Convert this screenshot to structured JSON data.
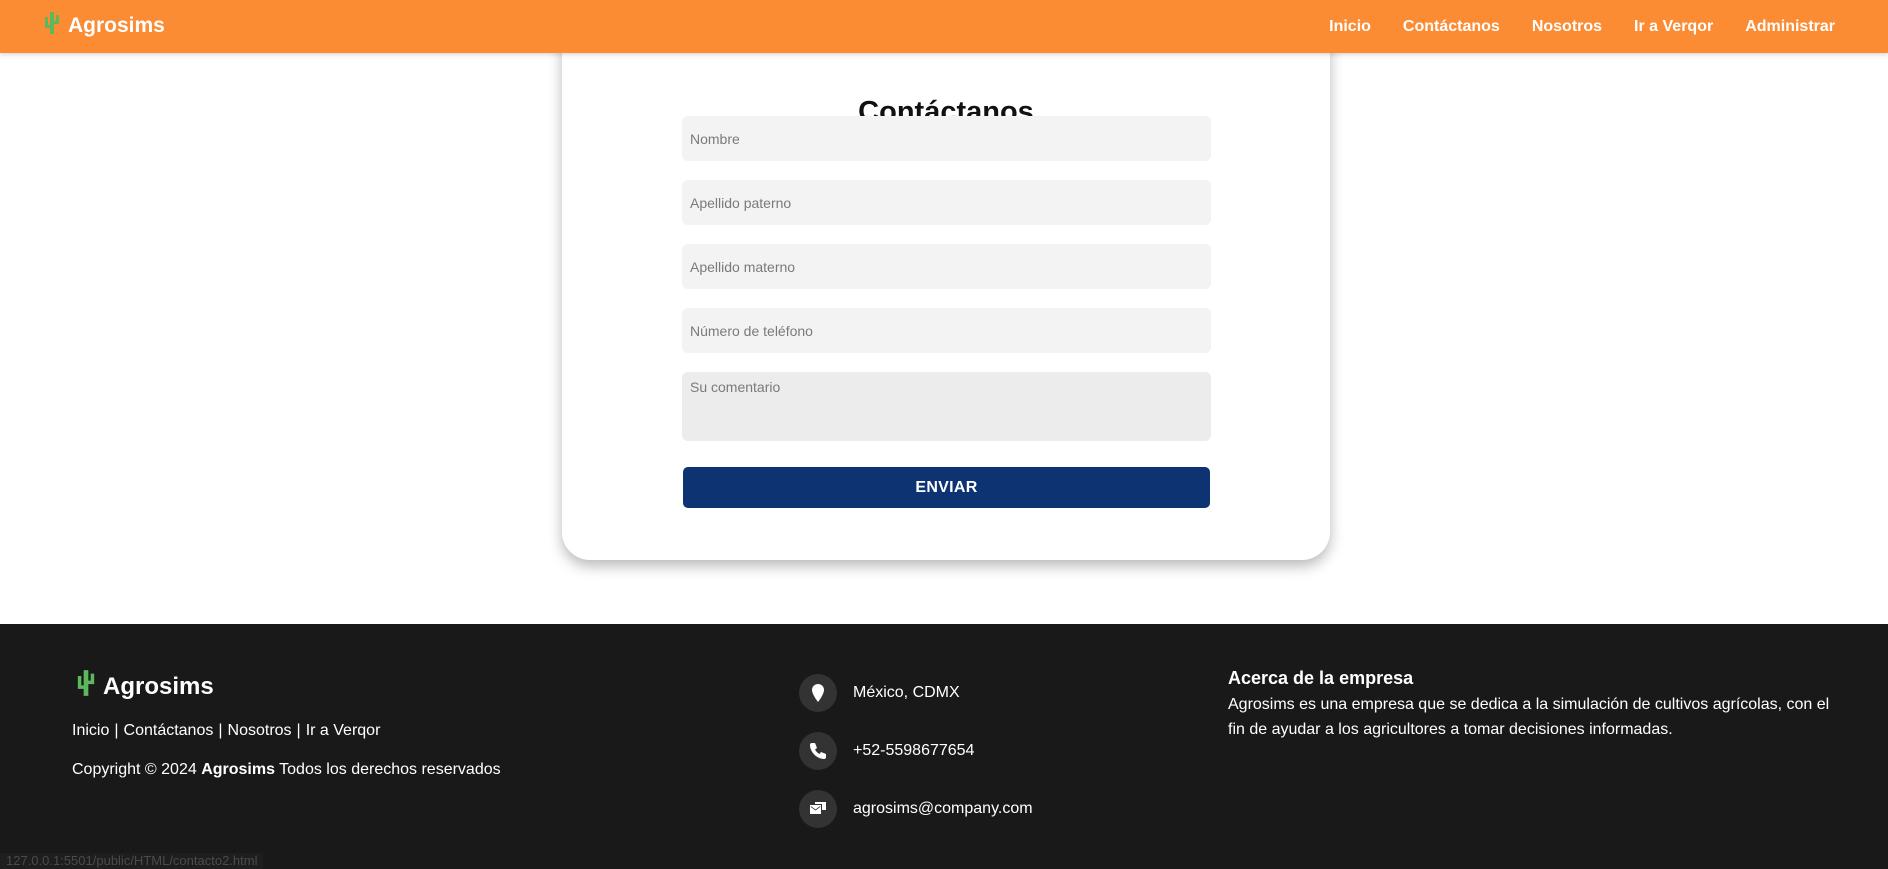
{
  "navbar": {
    "brand": "Agrosims",
    "links": [
      "Inicio",
      "Contáctanos",
      "Nosotros",
      "Ir a Verqor",
      "Administrar"
    ]
  },
  "form": {
    "title": "Contáctanos",
    "fields": [
      {
        "placeholder": "Nombre"
      },
      {
        "placeholder": "Apellido paterno"
      },
      {
        "placeholder": "Apellido materno"
      },
      {
        "placeholder": "Número de teléfono"
      }
    ],
    "comment_placeholder": "Su comentario",
    "submit_label": "ENVIAR"
  },
  "footer": {
    "brand": "Agrosims",
    "links": [
      "Inicio",
      "Contáctanos",
      "Nosotros",
      "Ir a Verqor"
    ],
    "separator": "|",
    "copyright_prefix": "Copyright © 2024",
    "copyright_brand": "Agrosims",
    "copyright_suffix": "Todos los derechos reservados",
    "contact": {
      "location": "México, CDMX",
      "phone": "+52-5598677654",
      "email": "agrosims@company.com"
    },
    "about_title": "Acerca de la empresa",
    "about_text": "Agrosims es una empresa que se dedica a la simulación de cultivos agrícolas, con el fin de ayudar a los agricultores a tomar decisiones informadas."
  },
  "status_bar": {
    "url": "127.0.0.1:5501/public/HTML/contacto2.html"
  },
  "colors": {
    "navbar": "#fc8c34",
    "button": "#0e3372",
    "footer": "#191919",
    "cactus": "#5cb85c"
  },
  "icons": [
    "cactus-icon",
    "location-pin-icon",
    "phone-icon",
    "email-icon"
  ]
}
